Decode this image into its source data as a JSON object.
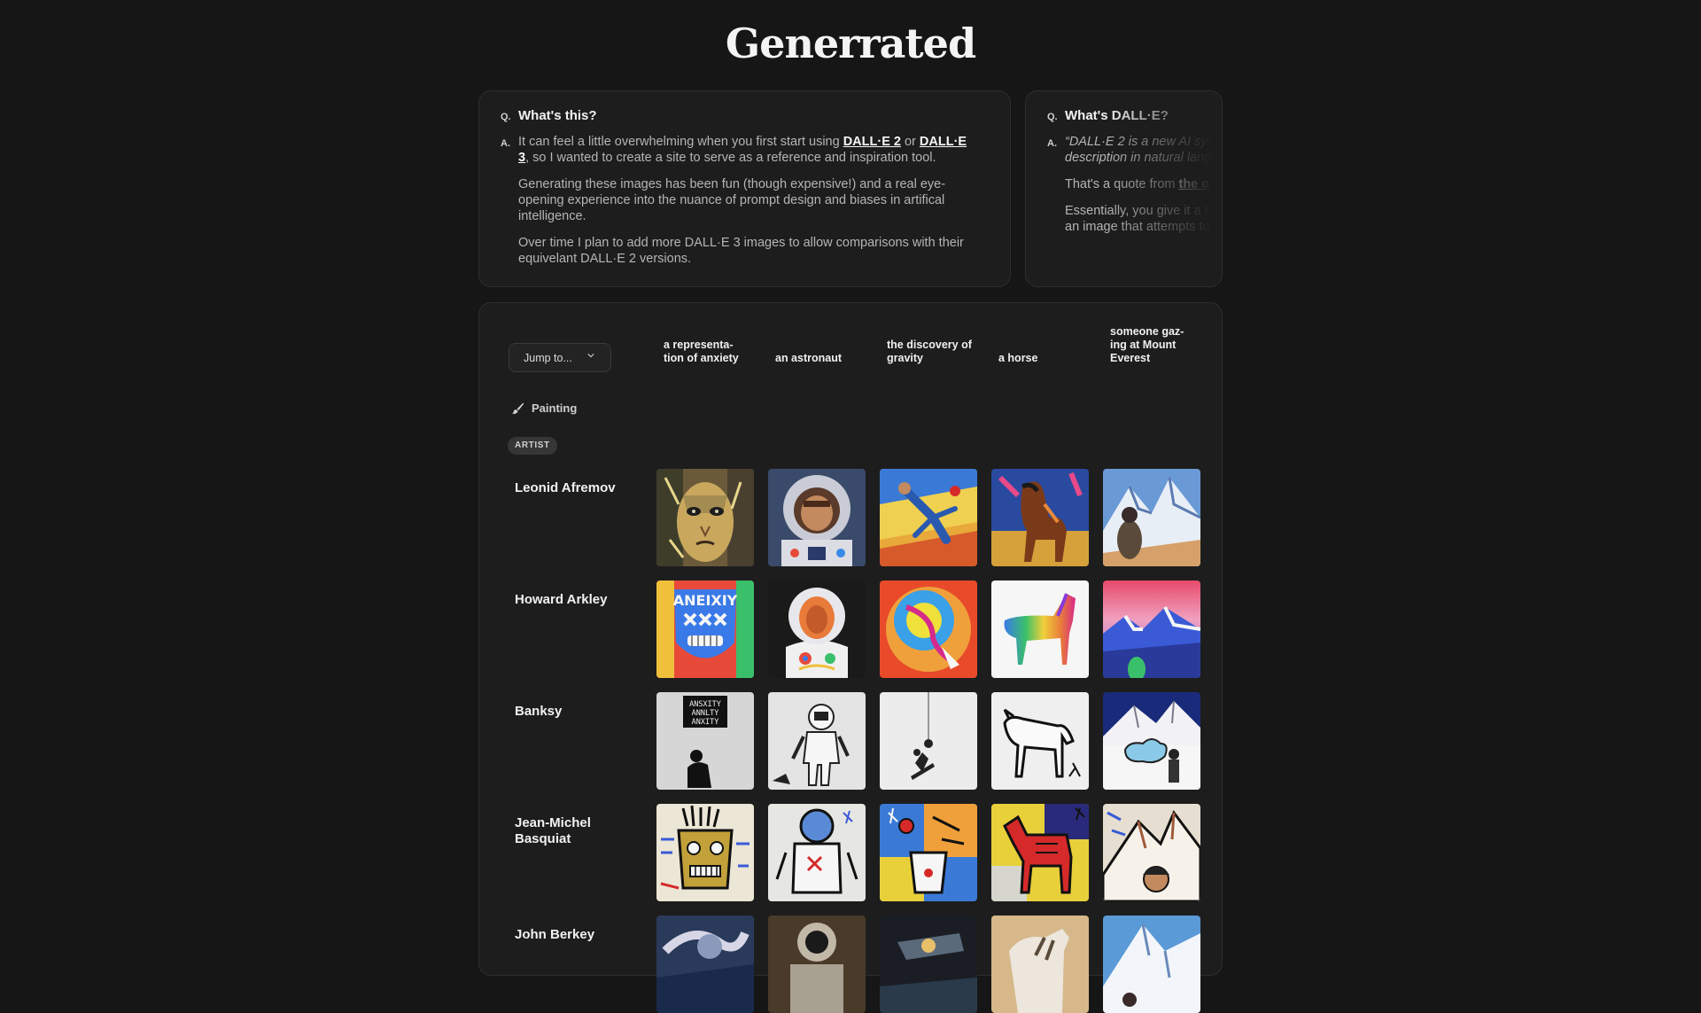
{
  "site": {
    "title": "Generrated"
  },
  "faq": [
    {
      "q_letter": "Q.",
      "a_letter": "A.",
      "question": "What's this?",
      "answer_intro": "It can feel a little overwhelming when you first start using ",
      "link1": "DALL·E 2",
      "or_text": " or ",
      "link2_line1": "DALL·E",
      "link2_line2": "3",
      "answer_rest": ", so I wanted to create a site to serve as a reference and inspiration tool.",
      "para2": "Generating these images has been fun (though expensive!) and a real eye-opening experience into the nuance of prompt design and biases in artifical intelligence.",
      "para3": "Over time I plan to add more DALL·E 3 images to allow comparisons with their equivelant DALL·E 2 versions."
    },
    {
      "q_letter": "Q.",
      "a_letter": "A.",
      "question": "What's DALL·E?",
      "quote_line1": "“DALL·E 2 is a new AI sys",
      "quote_line2": "description in natural lang",
      "para2_text": "That's a quote from ",
      "para2_link": "the o",
      "para3_line1": "Essentially, you give it a t",
      "para3_line2": "an image that attempts to"
    }
  ],
  "gallery": {
    "jump_label": "Jump to...",
    "medium_label": "Painting",
    "section_badge": "ARTIST",
    "columns": [
      "a representa- tion of anxiety",
      "an astronaut",
      "the discovery of gravity",
      "a horse",
      "someone gaz- ing at Mount Everest"
    ],
    "artists": [
      "Leonid Afremov",
      "Howard Arkley",
      "Banksy",
      "Jean-Michel Basquiat",
      "John Berkey"
    ],
    "banksy_sign_text": [
      "ANSXITY",
      "ANNLTY",
      "ANXITY"
    ],
    "arkley_face_text": "ANEIXIY"
  }
}
